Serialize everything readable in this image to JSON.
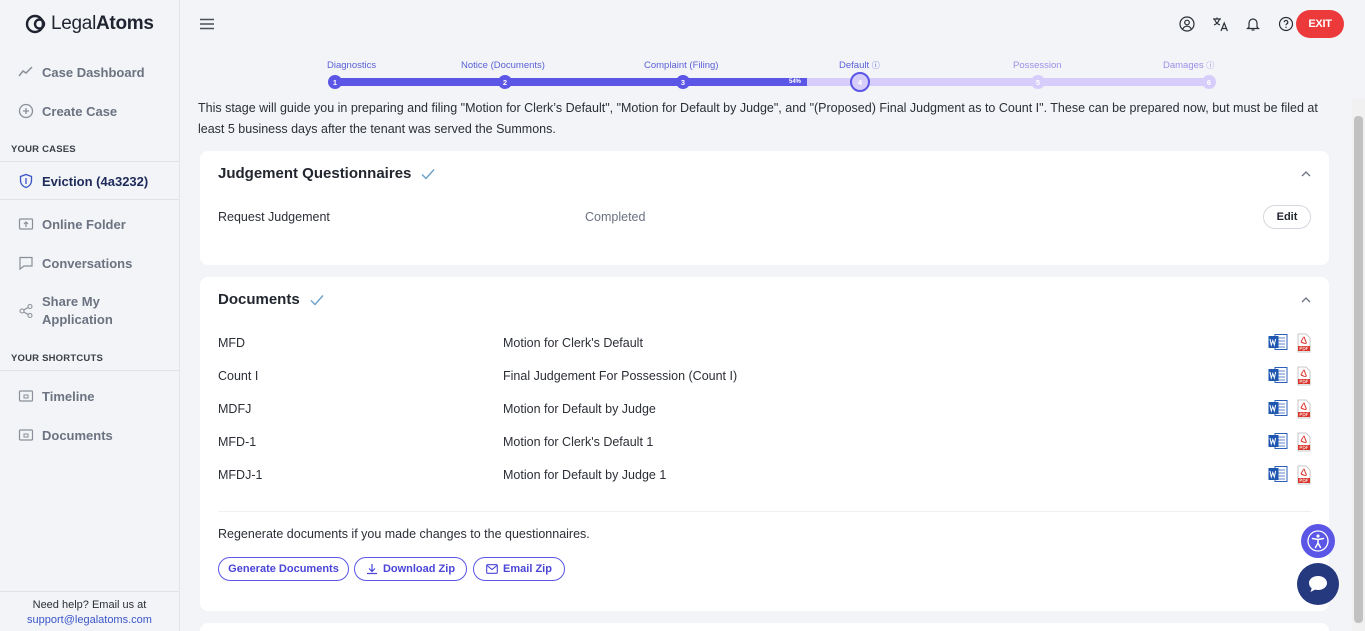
{
  "brand": {
    "name_part1": "Legal",
    "name_part2": "Atoms"
  },
  "sidebar": {
    "items": [
      {
        "label": "Case Dashboard",
        "icon": "trend-icon"
      },
      {
        "label": "Create Case",
        "icon": "plus-circle-icon"
      }
    ],
    "section_cases": "YOUR CASES",
    "active_case": "Eviction (4a3232)",
    "case_items": [
      {
        "label": "Online Folder",
        "icon": "folder-upload-icon"
      },
      {
        "label": "Conversations",
        "icon": "chat-icon"
      },
      {
        "label": "Share My Application",
        "icon": "share-icon"
      }
    ],
    "section_shortcuts": "YOUR SHORTCUTS",
    "shortcut_items": [
      {
        "label": "Timeline",
        "icon": "folder-icon"
      },
      {
        "label": "Documents",
        "icon": "folder-icon"
      }
    ],
    "help_text": "Need help? Email us at",
    "help_email": "support@legalatoms.com"
  },
  "header": {
    "exit_label": "EXIT"
  },
  "stepper": {
    "steps": [
      {
        "label": "Diagnostics",
        "num": "1",
        "state": "done"
      },
      {
        "label": "Notice (Documents)",
        "num": "2",
        "state": "done"
      },
      {
        "label": "Complaint (Filing)",
        "num": "3",
        "state": "done"
      },
      {
        "label": "Default",
        "num": "4",
        "state": "current"
      },
      {
        "label": "Possession",
        "num": "5",
        "state": "pending"
      },
      {
        "label": "Damages",
        "num": "6",
        "state": "pending"
      }
    ],
    "progress_percent": 54,
    "progress_label": "54%"
  },
  "intro": "This stage will guide you in preparing and filing \"Motion for Clerk’s Default\", \"Motion for Default by Judge\", and \"(Proposed) Final Judgment as to Count I\". These can be prepared now, but must be filed at least 5 business days after the tenant was served the Summons.",
  "questionnaires": {
    "title": "Judgement Questionnaires",
    "rows": [
      {
        "name": "Request Judgement",
        "status": "Completed",
        "action": "Edit"
      }
    ]
  },
  "documents": {
    "title": "Documents",
    "rows": [
      {
        "code": "MFD",
        "name": "Motion for Clerk's Default"
      },
      {
        "code": "Count I",
        "name": "Final Judgement For Possession (Count I)"
      },
      {
        "code": "MDFJ",
        "name": "Motion for Default by Judge"
      },
      {
        "code": "MFD-1",
        "name": "Motion for Clerk's Default 1"
      },
      {
        "code": "MFDJ-1",
        "name": "Motion for Default by Judge 1"
      }
    ],
    "regenerate_note": "Regenerate documents if you made changes to the questionnaires.",
    "generate_label": "Generate Documents",
    "download_label": "Download Zip",
    "email_label": "Email Zip"
  },
  "colors": {
    "accent": "#5b56e6",
    "exit": "#ec3a3a",
    "chat": "#24397e"
  }
}
